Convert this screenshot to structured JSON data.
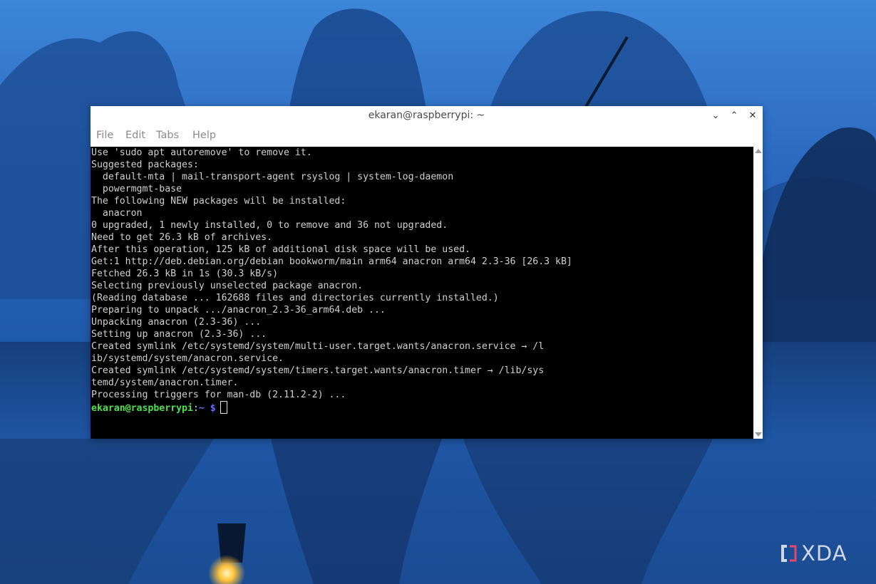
{
  "window": {
    "title": "ekaran@raspberrypi: ~",
    "controls": {
      "minimize": "⌄",
      "maximize": "⌃",
      "close": "✕"
    }
  },
  "menu": [
    "File",
    "Edit",
    "Tabs",
    "Help"
  ],
  "terminal": {
    "lines": [
      "Use 'sudo apt autoremove' to remove it.",
      "Suggested packages:",
      "  default-mta | mail-transport-agent rsyslog | system-log-daemon",
      "  powermgmt-base",
      "The following NEW packages will be installed:",
      "  anacron",
      "0 upgraded, 1 newly installed, 0 to remove and 36 not upgraded.",
      "Need to get 26.3 kB of archives.",
      "After this operation, 125 kB of additional disk space will be used.",
      "Get:1 http://deb.debian.org/debian bookworm/main arm64 anacron arm64 2.3-36 [26.3 kB]",
      "Fetched 26.3 kB in 1s (30.3 kB/s)",
      "Selecting previously unselected package anacron.",
      "(Reading database ... 162688 files and directories currently installed.)",
      "Preparing to unpack .../anacron_2.3-36_arm64.deb ...",
      "Unpacking anacron (2.3-36) ...",
      "Setting up anacron (2.3-36) ...",
      "Created symlink /etc/systemd/system/multi-user.target.wants/anacron.service → /l",
      "ib/systemd/system/anacron.service.",
      "Created symlink /etc/systemd/system/timers.target.wants/anacron.timer → /lib/sys",
      "temd/system/anacron.timer.",
      "Processing triggers for man-db (2.11.2-2) ..."
    ],
    "prompt": {
      "user_host": "ekaran@raspberrypi",
      "separator": ":",
      "path": "~",
      "symbol": "$"
    },
    "colors": {
      "background": "#000000",
      "text": "#d0d0d0",
      "prompt_user": "#4fe04b",
      "prompt_path": "#6f6cf6"
    }
  },
  "watermark": {
    "text": "XDA"
  },
  "colors": {
    "desktop_blue": "#2a66be",
    "window_bg": "#ffffff"
  }
}
